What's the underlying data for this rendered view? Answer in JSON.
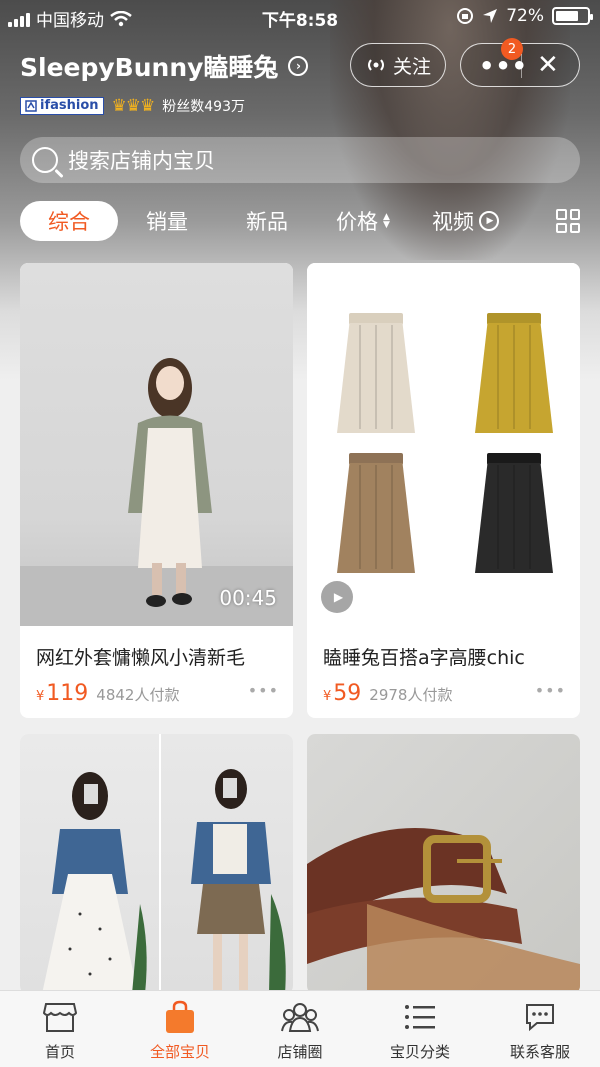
{
  "status_bar": {
    "carrier": "中国移动",
    "time": "下午8:58",
    "battery": "72%",
    "battery_level": 0.72
  },
  "shop": {
    "name": "SleepyBunny瞌睡兔",
    "badge_text": "ifashion",
    "followers": "粉丝数493万",
    "follow_label": "关注",
    "notification_count": "2"
  },
  "search": {
    "placeholder": "搜索店铺内宝贝"
  },
  "tabs": [
    {
      "label": "综合"
    },
    {
      "label": "销量"
    },
    {
      "label": "新品"
    },
    {
      "label": "价格"
    },
    {
      "label": "视频"
    }
  ],
  "products": [
    {
      "title": "网红外套慵懒风小清新毛",
      "currency": "¥",
      "price": "119",
      "sold": "4842人付款",
      "duration": "00:45"
    },
    {
      "title": "瞌睡兔百搭a字高腰chic",
      "currency": "¥",
      "price": "59",
      "sold": "2978人付款"
    }
  ],
  "bottom_nav": [
    {
      "label": "首页",
      "icon": "shop-icon"
    },
    {
      "label": "全部宝贝",
      "icon": "bag-icon"
    },
    {
      "label": "店铺圈",
      "icon": "people-icon"
    },
    {
      "label": "宝贝分类",
      "icon": "list-icon"
    },
    {
      "label": "联系客服",
      "icon": "chat-icon"
    }
  ],
  "colors": {
    "accent": "#f15a22",
    "crown": "#f2b21f",
    "ifashion": "#2a4ea8"
  }
}
